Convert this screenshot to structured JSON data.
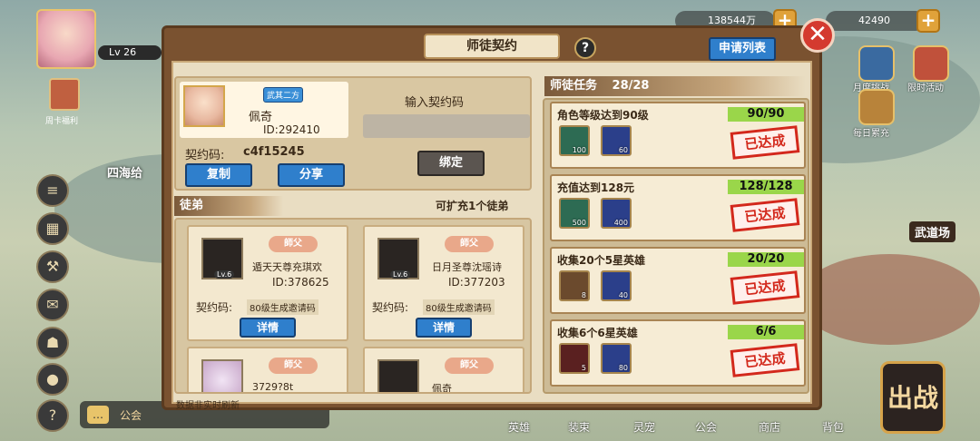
{
  "hud": {
    "level": "Lv 26",
    "weekly_card": "周卡福利",
    "resource1": "138544万",
    "resource2": "42490",
    "right_icons": [
      "月度挑战",
      "限时活动",
      "每日累充"
    ],
    "left_zone": "四海给",
    "right_zone": "武道场",
    "bottom_nav": [
      "英雄",
      "装束",
      "灵宠",
      "公会",
      "商店",
      "背包"
    ],
    "chat_channel": "公会",
    "fight": "出战"
  },
  "dialog": {
    "title": "师徒契约",
    "help": "?",
    "apply_list": "申请列表",
    "close": "✕",
    "me": {
      "badge": "武其二方",
      "name": "佩奇",
      "id": "ID:292410",
      "contract_label": "契约码:",
      "contract_code": "c4f15245",
      "copy": "复制",
      "share": "分享"
    },
    "input_code_label": "输入契约码",
    "bind": "绑定",
    "disciples_title": "徒弟",
    "expand": "可扩充1个徒弟",
    "disciples": [
      {
        "badge": "師父",
        "name": "遁天天尊充琪欢",
        "id": "ID:378625",
        "lv": "Lv.6",
        "code_label": "契约码:",
        "code": "80级生成邀请码",
        "detail": "详情"
      },
      {
        "badge": "師父",
        "name": "日月圣尊沈瑶诗",
        "id": "ID:377203",
        "lv": "Lv.6",
        "code_label": "契约码:",
        "code": "80级生成邀请码",
        "detail": "详情"
      },
      {
        "badge": "師父",
        "name": "3729?8t",
        "id": "",
        "lv": "",
        "code_label": "",
        "code": "",
        "detail": ""
      },
      {
        "badge": "師父",
        "name": "佩奇",
        "id": "",
        "lv": "",
        "code_label": "",
        "code": "",
        "detail": ""
      }
    ],
    "tasks_title": "师徒任务",
    "tasks_count": "28/28",
    "tasks": [
      {
        "title": "角色等级达到90级",
        "progress": "90/90",
        "fraction": 1.0,
        "items": [
          {
            "icon": "jade",
            "count": "100",
            "color": "#2d6b53"
          },
          {
            "icon": "orb",
            "count": "60",
            "color": "#2b3f8a"
          }
        ],
        "status": "已达成"
      },
      {
        "title": "充值达到128元",
        "progress": "128/128",
        "fraction": 1.0,
        "items": [
          {
            "icon": "jade",
            "count": "500",
            "color": "#2d6b53"
          },
          {
            "icon": "orb",
            "count": "400",
            "color": "#2b3f8a"
          }
        ],
        "status": "已达成"
      },
      {
        "title": "收集20个5星英雄",
        "progress": "20/20",
        "fraction": 1.0,
        "items": [
          {
            "icon": "scroll",
            "count": "8",
            "color": "#6b4a2d"
          },
          {
            "icon": "orb",
            "count": "40",
            "color": "#2b3f8a"
          }
        ],
        "status": "已达成"
      },
      {
        "title": "收集6个6星英雄",
        "progress": "6/6",
        "fraction": 1.0,
        "items": [
          {
            "icon": "hammer",
            "count": "5",
            "color": "#5a2020"
          },
          {
            "icon": "orb",
            "count": "80",
            "color": "#2b3f8a"
          }
        ],
        "status": "已达成"
      }
    ],
    "footnote": "数据非实时刷新"
  }
}
